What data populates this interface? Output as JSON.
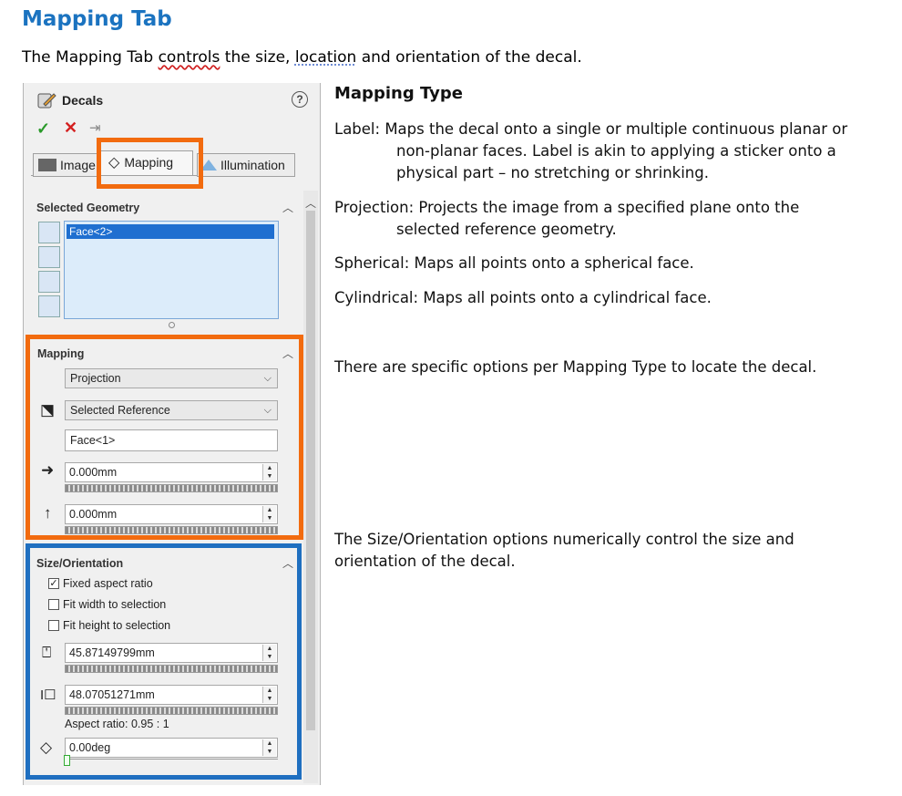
{
  "heading": "Mapping Tab",
  "intro": {
    "before": "The Mapping Tab ",
    "w1": "controls",
    "mid": " the size, ",
    "w2": "location",
    "after": " and orientation of the decal."
  },
  "panel": {
    "title": "Decals",
    "help": "?",
    "tabs": [
      "Image",
      "Mapping",
      "Illumination"
    ],
    "selected_geometry": {
      "title": "Selected Geometry",
      "items": [
        "Face<2>"
      ]
    },
    "mapping": {
      "title": "Mapping",
      "type": "Projection",
      "reference": "Selected Reference",
      "face": "Face<1>",
      "horizontal": "0.000mm",
      "vertical": "0.000mm"
    },
    "size_orientation": {
      "title": "Size/Orientation",
      "checkboxes": [
        {
          "label": "Fixed aspect ratio",
          "checked": true
        },
        {
          "label": "Fit width to selection",
          "checked": false
        },
        {
          "label": "Fit height to selection",
          "checked": false
        }
      ],
      "height": "45.87149799mm",
      "width": "48.07051271mm",
      "aspect_ratio": "Aspect ratio: 0.95 : 1",
      "rotation": "0.00deg"
    },
    "colors": {
      "highlight_orange": "#f26b0f",
      "highlight_blue": "#1f6fc0"
    }
  },
  "right": {
    "title": "Mapping Type",
    "label_desc": [
      "Label:  Maps the decal onto a single or multiple continuous planar or",
      "non-planar faces.   Label is akin to applying a sticker onto a",
      "physical part – no stretching or shrinking."
    ],
    "projection_desc": [
      "Projection:  Projects the image from a specified plane onto the",
      "selected reference geometry."
    ],
    "spherical_desc": "Spherical:  Maps all points onto a spherical face.",
    "cylindrical_desc": "Cylindrical:  Maps all points onto a cylindrical face.",
    "options_note": "There are specific options per Mapping Type to locate the decal.",
    "size_note": [
      "The Size/Orientation options numerically control the size and",
      "orientation of the decal."
    ]
  }
}
